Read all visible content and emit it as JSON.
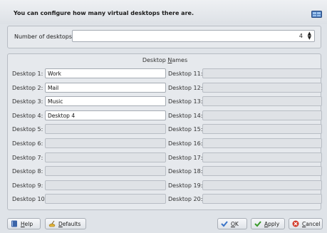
{
  "header": {
    "text": "You can configure how many virtual desktops there are."
  },
  "count": {
    "label": "Number of desktops:",
    "value": "4"
  },
  "names": {
    "title_prefix": "Desktop ",
    "title_underlined": "N",
    "title_suffix": "ames",
    "rows": [
      {
        "label": "Desktop 1:",
        "value": "Work"
      },
      {
        "label": "Desktop 2:",
        "value": "Mail"
      },
      {
        "label": "Desktop 3:",
        "value": "Music"
      },
      {
        "label": "Desktop 4:",
        "value": "Desktop 4"
      },
      {
        "label": "Desktop 5:",
        "value": ""
      },
      {
        "label": "Desktop 6:",
        "value": ""
      },
      {
        "label": "Desktop 7:",
        "value": ""
      },
      {
        "label": "Desktop 8:",
        "value": ""
      },
      {
        "label": "Desktop 9:",
        "value": ""
      },
      {
        "label": "Desktop 10:",
        "value": ""
      },
      {
        "label": "Desktop 11:",
        "value": ""
      },
      {
        "label": "Desktop 12:",
        "value": ""
      },
      {
        "label": "Desktop 13:",
        "value": ""
      },
      {
        "label": "Desktop 14:",
        "value": ""
      },
      {
        "label": "Desktop 15:",
        "value": ""
      },
      {
        "label": "Desktop 16:",
        "value": ""
      },
      {
        "label": "Desktop 17:",
        "value": ""
      },
      {
        "label": "Desktop 18:",
        "value": ""
      },
      {
        "label": "Desktop 19:",
        "value": ""
      },
      {
        "label": "Desktop 20:",
        "value": ""
      }
    ]
  },
  "buttons": {
    "help": {
      "pre": "",
      "u": "H",
      "post": "elp"
    },
    "defaults": {
      "pre": "",
      "u": "D",
      "post": "efaults"
    },
    "ok": {
      "pre": "",
      "u": "O",
      "post": "K"
    },
    "apply": {
      "pre": "",
      "u": "A",
      "post": "pply"
    },
    "cancel": {
      "pre": "",
      "u": "C",
      "post": "ancel"
    }
  },
  "icons": {
    "header": "virtual-desktops-icon",
    "help": "help-book-icon",
    "defaults": "defaults-broom-icon",
    "ok": "checkmark-icon",
    "apply": "checkmark-icon",
    "cancel": "cancel-icon"
  },
  "colors": {
    "ok_check": "#3a74c8",
    "apply_check": "#3a9a2a",
    "cancel_red": "#d23a2a"
  }
}
